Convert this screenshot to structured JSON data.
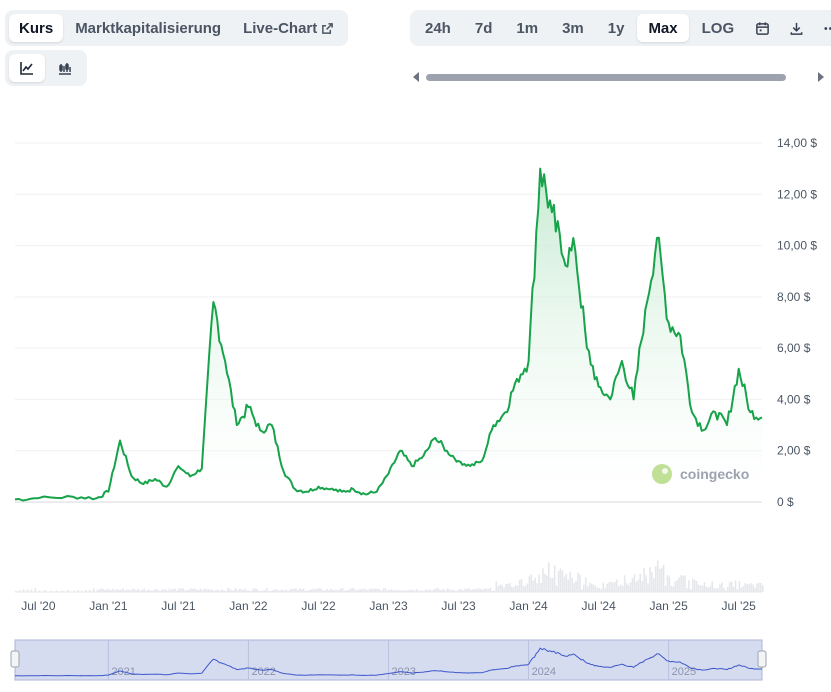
{
  "tabs": [
    {
      "label": "Kurs",
      "active": true
    },
    {
      "label": "Marktkapitalisierung",
      "active": false
    },
    {
      "label": "Live-Chart",
      "active": false,
      "icon": "external-link-icon"
    }
  ],
  "chart_types": [
    {
      "icon": "line-chart-icon",
      "active": true
    },
    {
      "icon": "candlestick-icon",
      "active": false
    }
  ],
  "ranges": [
    {
      "label": "24h",
      "active": false
    },
    {
      "label": "7d",
      "active": false
    },
    {
      "label": "1m",
      "active": false
    },
    {
      "label": "3m",
      "active": false
    },
    {
      "label": "1y",
      "active": false
    },
    {
      "label": "Max",
      "active": true
    },
    {
      "label": "LOG",
      "active": false
    }
  ],
  "range_icons": [
    "calendar-icon",
    "download-icon",
    "more-icon"
  ],
  "watermark": "coingecko",
  "colors": {
    "line": "#16a34a",
    "area_top": "#bfe8cc",
    "volume": "#e5e7eb",
    "navigator": "#d6dcf0",
    "navigator_line": "#3c57c9"
  },
  "chart_data": {
    "type": "area",
    "y_unit": "$",
    "ylim": [
      0,
      14
    ],
    "y_ticks": [
      "0 $",
      "2,00 $",
      "4,00 $",
      "6,00 $",
      "8,00 $",
      "10,00 $",
      "12,00 $",
      "14,00 $"
    ],
    "x_ticks": [
      "Jul '20",
      "Jan '21",
      "Jul '21",
      "Jan '22",
      "Jul '22",
      "Jan '23",
      "Jul '23",
      "Jan '24",
      "Jul '24",
      "Jan '25",
      "Jul '25"
    ],
    "grid": true,
    "series": [
      {
        "x": [
          "2020-05",
          "2020-07",
          "2020-10",
          "2020-12",
          "2021-01",
          "2021-02",
          "2021-03",
          "2021-04",
          "2021-05",
          "2021-06",
          "2021-07",
          "2021-08",
          "2021-09",
          "2021-10",
          "2021-11",
          "2021-12",
          "2022-01",
          "2022-02",
          "2022-03",
          "2022-04",
          "2022-05",
          "2022-06",
          "2022-07",
          "2022-08",
          "2022-09",
          "2022-10",
          "2022-11",
          "2022-12",
          "2023-01",
          "2023-02",
          "2023-03",
          "2023-04",
          "2023-05",
          "2023-06",
          "2023-07",
          "2023-08",
          "2023-09",
          "2023-10",
          "2023-11",
          "2023-12",
          "2024-01",
          "2024-02",
          "2024-03",
          "2024-04",
          "2024-05",
          "2024-06",
          "2024-07",
          "2024-08",
          "2024-09",
          "2024-10",
          "2024-11",
          "2024-12",
          "2025-01",
          "2025-02",
          "2025-03",
          "2025-04",
          "2025-05",
          "2025-06",
          "2025-07",
          "2025-08",
          "2025-09"
        ],
        "values": [
          0.1,
          0.15,
          0.2,
          0.15,
          0.4,
          2.4,
          1.0,
          0.7,
          0.9,
          0.6,
          1.4,
          1.0,
          1.3,
          7.8,
          5.5,
          3.0,
          3.7,
          2.8,
          3.0,
          1.2,
          0.5,
          0.4,
          0.6,
          0.5,
          0.4,
          0.5,
          0.3,
          0.4,
          1.1,
          2.0,
          1.4,
          1.8,
          2.5,
          2.0,
          1.6,
          1.4,
          1.6,
          3.0,
          3.5,
          4.8,
          5.5,
          13.0,
          11.3,
          9.5,
          9.8,
          6.0,
          4.5,
          4.0,
          5.5,
          4.0,
          7.5,
          10.3,
          7.0,
          6.5,
          3.5,
          2.8,
          3.5,
          3.0,
          5.2,
          3.5,
          3.3
        ]
      }
    ],
    "volume_peaks": [
      "2024-03",
      "2024-12"
    ]
  },
  "navigator": {
    "year_labels": [
      "2021",
      "2022",
      "2023",
      "2024",
      "2025"
    ]
  }
}
